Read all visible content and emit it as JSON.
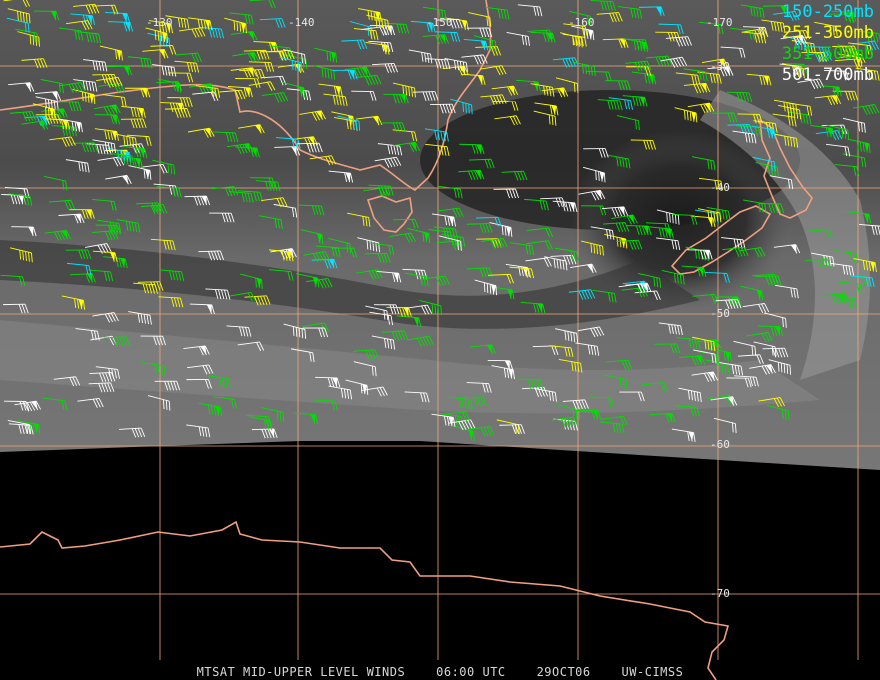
{
  "map": {
    "longitude_labels": [
      "-130",
      "-140",
      "-150",
      "-160",
      "-170"
    ],
    "latitude_labels": [
      "-30",
      "-40",
      "-50",
      "-60",
      "-70"
    ],
    "colors": {
      "gridline": "#f0a878",
      "coastline": "#f0a080",
      "night_background": "#000000",
      "band_150_250": "#00e5ff",
      "band_251_350": "#ffff00",
      "band_351_500": "#00e000",
      "band_501_700": "#ffffff"
    }
  },
  "legend": [
    {
      "label": "150-250mb",
      "color": "#00e5ff"
    },
    {
      "label": "251-350mb",
      "color": "#ffff00"
    },
    {
      "label": "351-500mb",
      "color": "#00e000"
    },
    {
      "label": "501-700mb",
      "color": "#ffffff"
    }
  ],
  "caption": {
    "product": "MTSAT MID-UPPER LEVEL WINDS",
    "time": "06:00 UTC",
    "date": "29OCT06",
    "source": "UW-CIMSS"
  }
}
